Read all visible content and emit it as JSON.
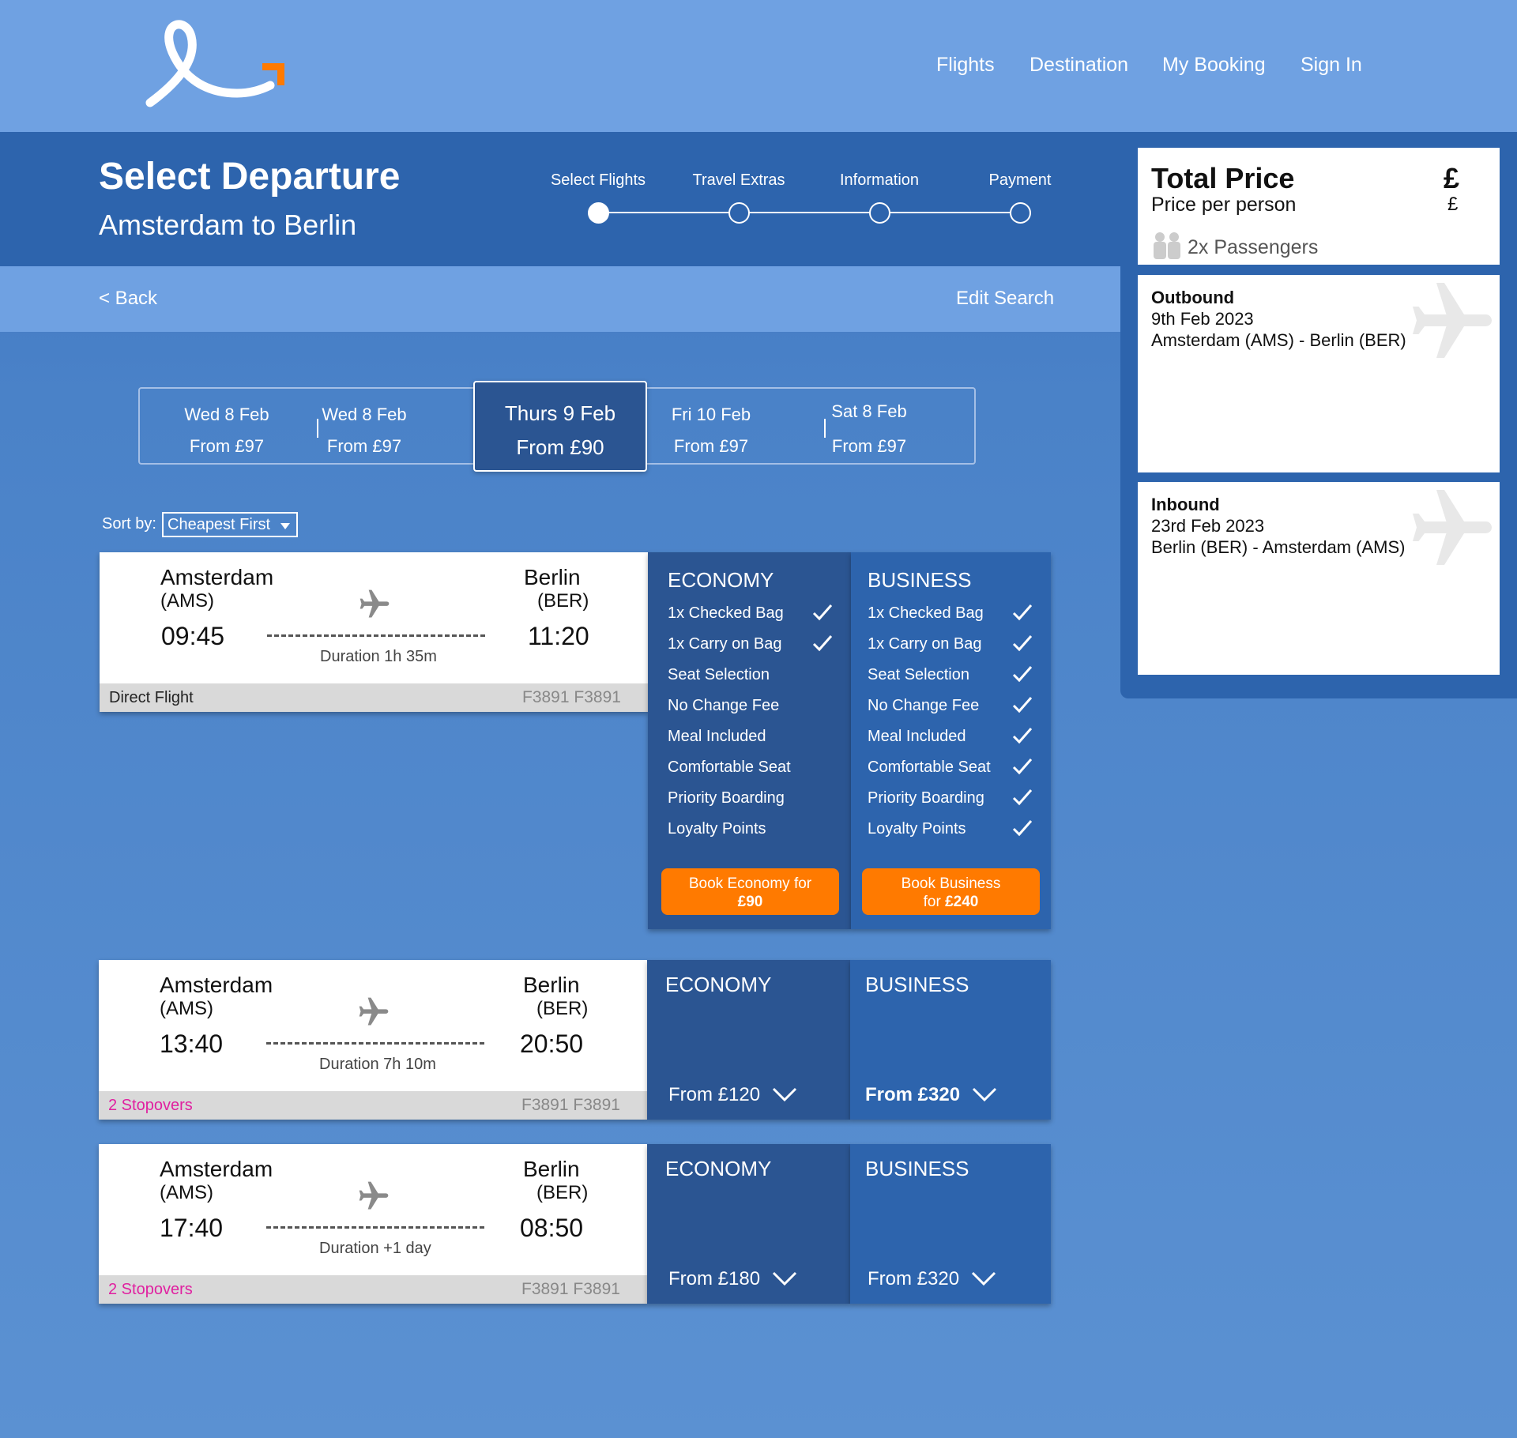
{
  "nav": {
    "links": [
      "Flights",
      "Destination",
      "My Booking",
      "Sign In"
    ],
    "accent": "#ff7a00"
  },
  "header": {
    "title": "Select Departure",
    "subtitle": "Amsterdam to Berlin",
    "steps": [
      "Select Flights",
      "Travel Extras",
      "Information",
      "Payment"
    ],
    "active_step": 0
  },
  "subbar": {
    "back": "< Back",
    "edit": "Edit Search"
  },
  "dates": [
    {
      "day": "Wed 8 Feb",
      "price": "From £97"
    },
    {
      "day": "Wed 8 Feb",
      "price": "From £97"
    },
    {
      "day": "Thurs 9 Feb",
      "price": "From £90",
      "selected": true
    },
    {
      "day": "Fri 10 Feb",
      "price": "From £97"
    },
    {
      "day": "Sat 8 Feb",
      "price": "From £97"
    }
  ],
  "sort": {
    "label": "Sort by:",
    "value": "Cheapest First"
  },
  "flights": [
    {
      "from_city": "Amsterdam",
      "from_code": "(AMS)",
      "dep": "09:45",
      "to_city": "Berlin",
      "to_code": "(BER)",
      "arr": "11:20",
      "duration": "Duration 1h 35m",
      "stops": "Direct Flight",
      "flight_numbers": "F3891  F3891",
      "economy": {
        "heading": "ECONOMY",
        "features": [
          "1x Checked Bag",
          "1x Carry on Bag",
          "Seat Selection",
          "No Change Fee",
          "Meal Included",
          "Comfortable Seat",
          "Priority Boarding",
          "Loyalty Points"
        ],
        "included": [
          true,
          true,
          false,
          false,
          false,
          false,
          false,
          false
        ],
        "button_line1": "Book Economy for",
        "button_line2": "£90"
      },
      "business": {
        "heading": "BUSINESS",
        "features": [
          "1x Checked Bag",
          "1x Carry on Bag",
          "Seat Selection",
          "No Change Fee",
          "Meal Included",
          "Comfortable Seat",
          "Priority Boarding",
          "Loyalty Points"
        ],
        "included": [
          true,
          true,
          true,
          true,
          true,
          true,
          true,
          true
        ],
        "button_line1": "Book Business",
        "button_line2_prefix": "for ",
        "button_line2_bold": "£240"
      }
    },
    {
      "from_city": "Amsterdam",
      "from_code": "(AMS)",
      "dep": "13:40",
      "to_city": "Berlin",
      "to_code": "(BER)",
      "arr": "20:50",
      "duration": "Duration 7h 10m",
      "stops": "2 Stopovers",
      "flight_numbers": "F3891  F3891",
      "economy": {
        "heading": "ECONOMY",
        "price": "From £120"
      },
      "business": {
        "heading": "BUSINESS",
        "price": "From £320"
      }
    },
    {
      "from_city": "Amsterdam",
      "from_code": "(AMS)",
      "dep": "17:40",
      "to_city": "Berlin",
      "to_code": "(BER)",
      "arr": "08:50",
      "duration": "Duration +1 day",
      "stops": "2 Stopovers",
      "flight_numbers": "F3891  F3891",
      "economy": {
        "heading": "ECONOMY",
        "price": "From £180"
      },
      "business": {
        "heading": "BUSINESS",
        "price": "From £320"
      }
    }
  ],
  "summary": {
    "title": "Total Price",
    "currency_large": "£",
    "subtitle": "Price per person",
    "currency_small": "£",
    "passengers": "2x Passengers",
    "outbound": {
      "label": "Outbound",
      "date": "9th Feb 2023",
      "route": "Amsterdam (AMS) - Berlin (BER)"
    },
    "inbound": {
      "label": "Inbound",
      "date": "23rd Feb 2023",
      "route": "Berlin (BER) - Amsterdam (AMS)"
    }
  }
}
